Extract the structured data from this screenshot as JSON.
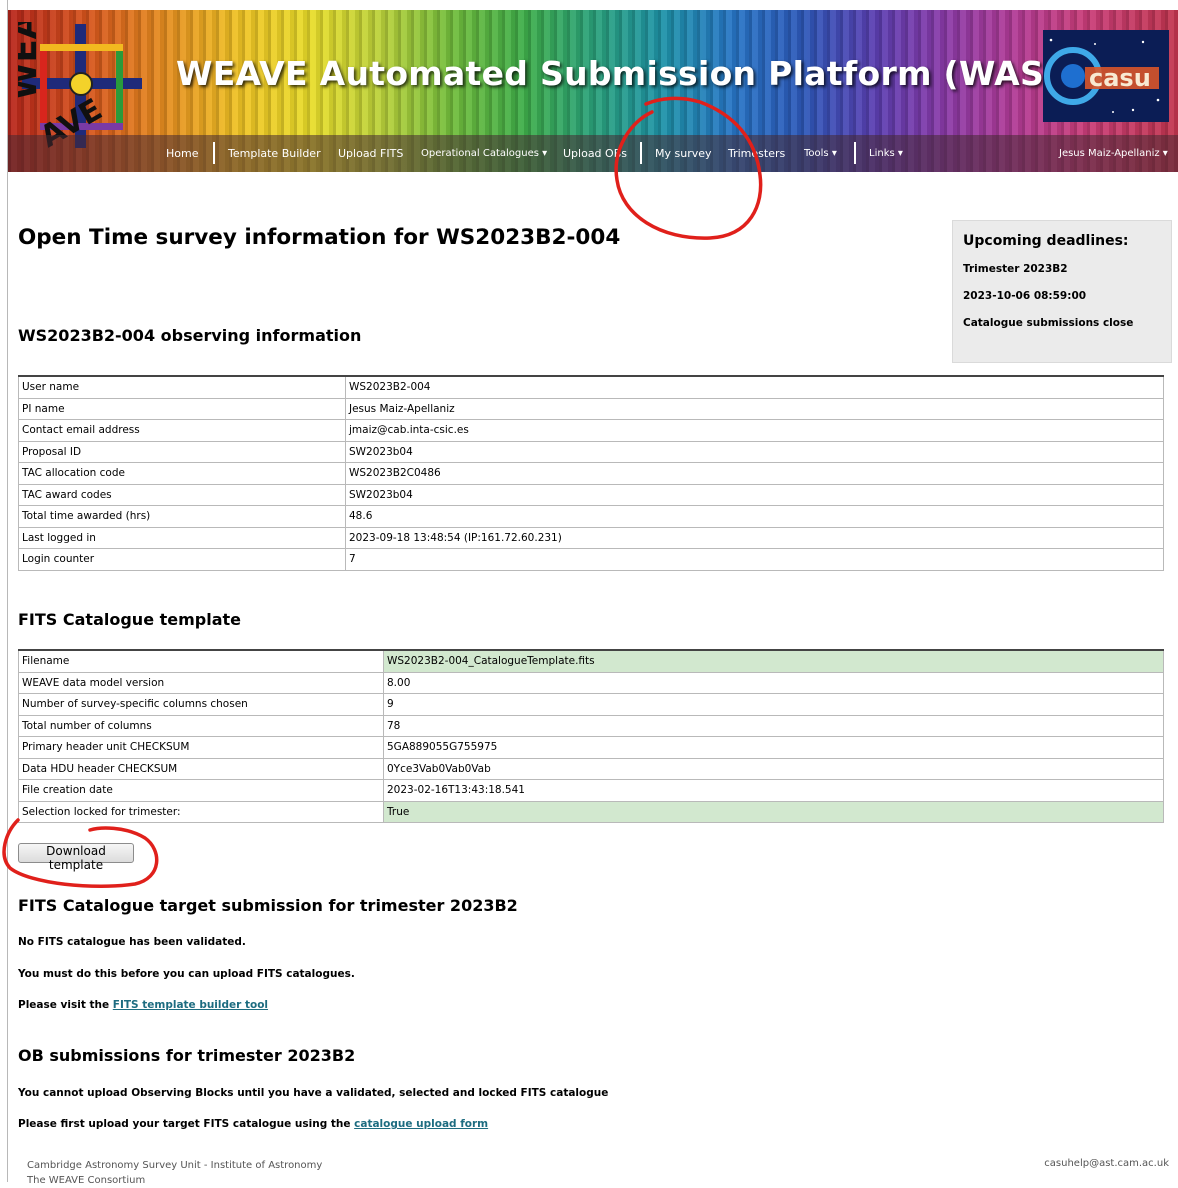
{
  "header": {
    "title": "WEAVE Automated Submission Platform (WASP)",
    "weave_logo_text": "WEAVE",
    "casu_logo_text": "casu"
  },
  "nav": {
    "home": "Home",
    "template_builder": "Template Builder",
    "upload_fits": "Upload FITS",
    "operational_catalogues": "Operational Catalogues",
    "upload_obs": "Upload OBs",
    "my_survey": "My survey",
    "trimesters": "Trimesters",
    "tools": "Tools",
    "links": "Links",
    "user": "Jesus Maiz-Apellaniz"
  },
  "page_title": "Open Time survey information for WS2023B2-004",
  "deadlines": {
    "heading": "Upcoming deadlines:",
    "trimester": "Trimester 2023B2",
    "datetime": "2023-10-06 08:59:00",
    "event": "Catalogue submissions close"
  },
  "observing": {
    "heading": "WS2023B2-004 observing information",
    "rows": [
      {
        "label": "User name",
        "value": "WS2023B2-004"
      },
      {
        "label": "PI name",
        "value": "Jesus Maiz-Apellaniz"
      },
      {
        "label": "Contact email address",
        "value": "jmaiz@cab.inta-csic.es"
      },
      {
        "label": "Proposal ID",
        "value": "SW2023b04"
      },
      {
        "label": "TAC allocation code",
        "value": "WS2023B2C0486"
      },
      {
        "label": "TAC award codes",
        "value": "SW2023b04"
      },
      {
        "label": "Total time awarded (hrs)",
        "value": "48.6"
      },
      {
        "label": "Last logged in",
        "value": "2023-09-18 13:48:54 (IP:161.72.60.231)"
      },
      {
        "label": "Login counter",
        "value": "7"
      }
    ]
  },
  "fits_template": {
    "heading": "FITS Catalogue template",
    "rows": [
      {
        "label": "Filename",
        "value": "WS2023B2-004_CatalogueTemplate.fits"
      },
      {
        "label": "WEAVE data model version",
        "value": "8.00"
      },
      {
        "label": "Number of survey-specific columns chosen",
        "value": "9"
      },
      {
        "label": "Total number of columns",
        "value": "78"
      },
      {
        "label": "Primary header unit CHECKSUM",
        "value": "5GA889055G755975"
      },
      {
        "label": "Data HDU header CHECKSUM",
        "value": "0Yce3Vab0Vab0Vab"
      },
      {
        "label": "File creation date",
        "value": "2023-02-16T13:43:18.541"
      },
      {
        "label": "Selection locked for trimester:",
        "value": "True"
      }
    ],
    "download_button": "Download template"
  },
  "target_submission": {
    "heading": "FITS Catalogue target submission for trimester 2023B2",
    "line1": "No FITS catalogue has been validated.",
    "line2": "You must do this before you can upload FITS catalogues.",
    "line3_prefix": "Please visit the ",
    "line3_link": "FITS template builder tool"
  },
  "ob_submissions": {
    "heading": "OB submissions for trimester 2023B2",
    "line1": "You cannot upload Observing Blocks until you have a validated, selected and locked FITS catalogue",
    "line2_prefix": "Please first upload your target FITS catalogue using the ",
    "line2_link": "catalogue upload form"
  },
  "footer": {
    "left_line1": "Cambridge Astronomy Survey Unit - Institute of Astronomy",
    "left_line2": "The WEAVE Consortium",
    "right": "casuhelp@ast.cam.ac.uk"
  },
  "colors": {
    "annotation_red": "#e0201b",
    "table_highlight": "#d2e8cf",
    "link": "#1d6c80",
    "deadline_bg": "#ebebeb"
  }
}
